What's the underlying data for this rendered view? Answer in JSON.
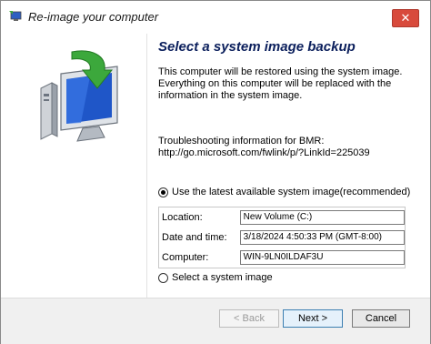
{
  "window": {
    "title": "Re-image your computer",
    "close_label": "✕"
  },
  "main": {
    "heading": "Select a system image backup",
    "description_line1": "This computer will be restored using the system image.",
    "description_line2": "Everything on this computer will be replaced with the",
    "description_line3": "information in the system image.",
    "troubleshoot_line1": "Troubleshooting information for BMR:",
    "troubleshoot_line2": "http://go.microsoft.com/fwlink/p/?LinkId=225039",
    "option_latest_label": "Use the latest available system image(recommended)",
    "option_latest_checked": true,
    "info": {
      "location_label": "Location:",
      "location_value": "New Volume (C:)",
      "datetime_label": "Date and time:",
      "datetime_value": "3/18/2024 4:50:33 PM (GMT-8:00)",
      "computer_label": "Computer:",
      "computer_value": "WIN-9LN0ILDAF3U"
    },
    "option_select_label": "Select a system image",
    "option_select_checked": false
  },
  "buttons": {
    "back_label": "< Back",
    "next_label": "Next >",
    "cancel_label": "Cancel"
  },
  "colors": {
    "heading": "#0b1f5c",
    "close": "#d84a3c",
    "arrow": "#3ca83c",
    "monitor_screen": "#1f56c8"
  },
  "icons": {
    "title_icon": "computer-restore-icon",
    "hero_icon": "monitor-restore-arrow-icon"
  }
}
